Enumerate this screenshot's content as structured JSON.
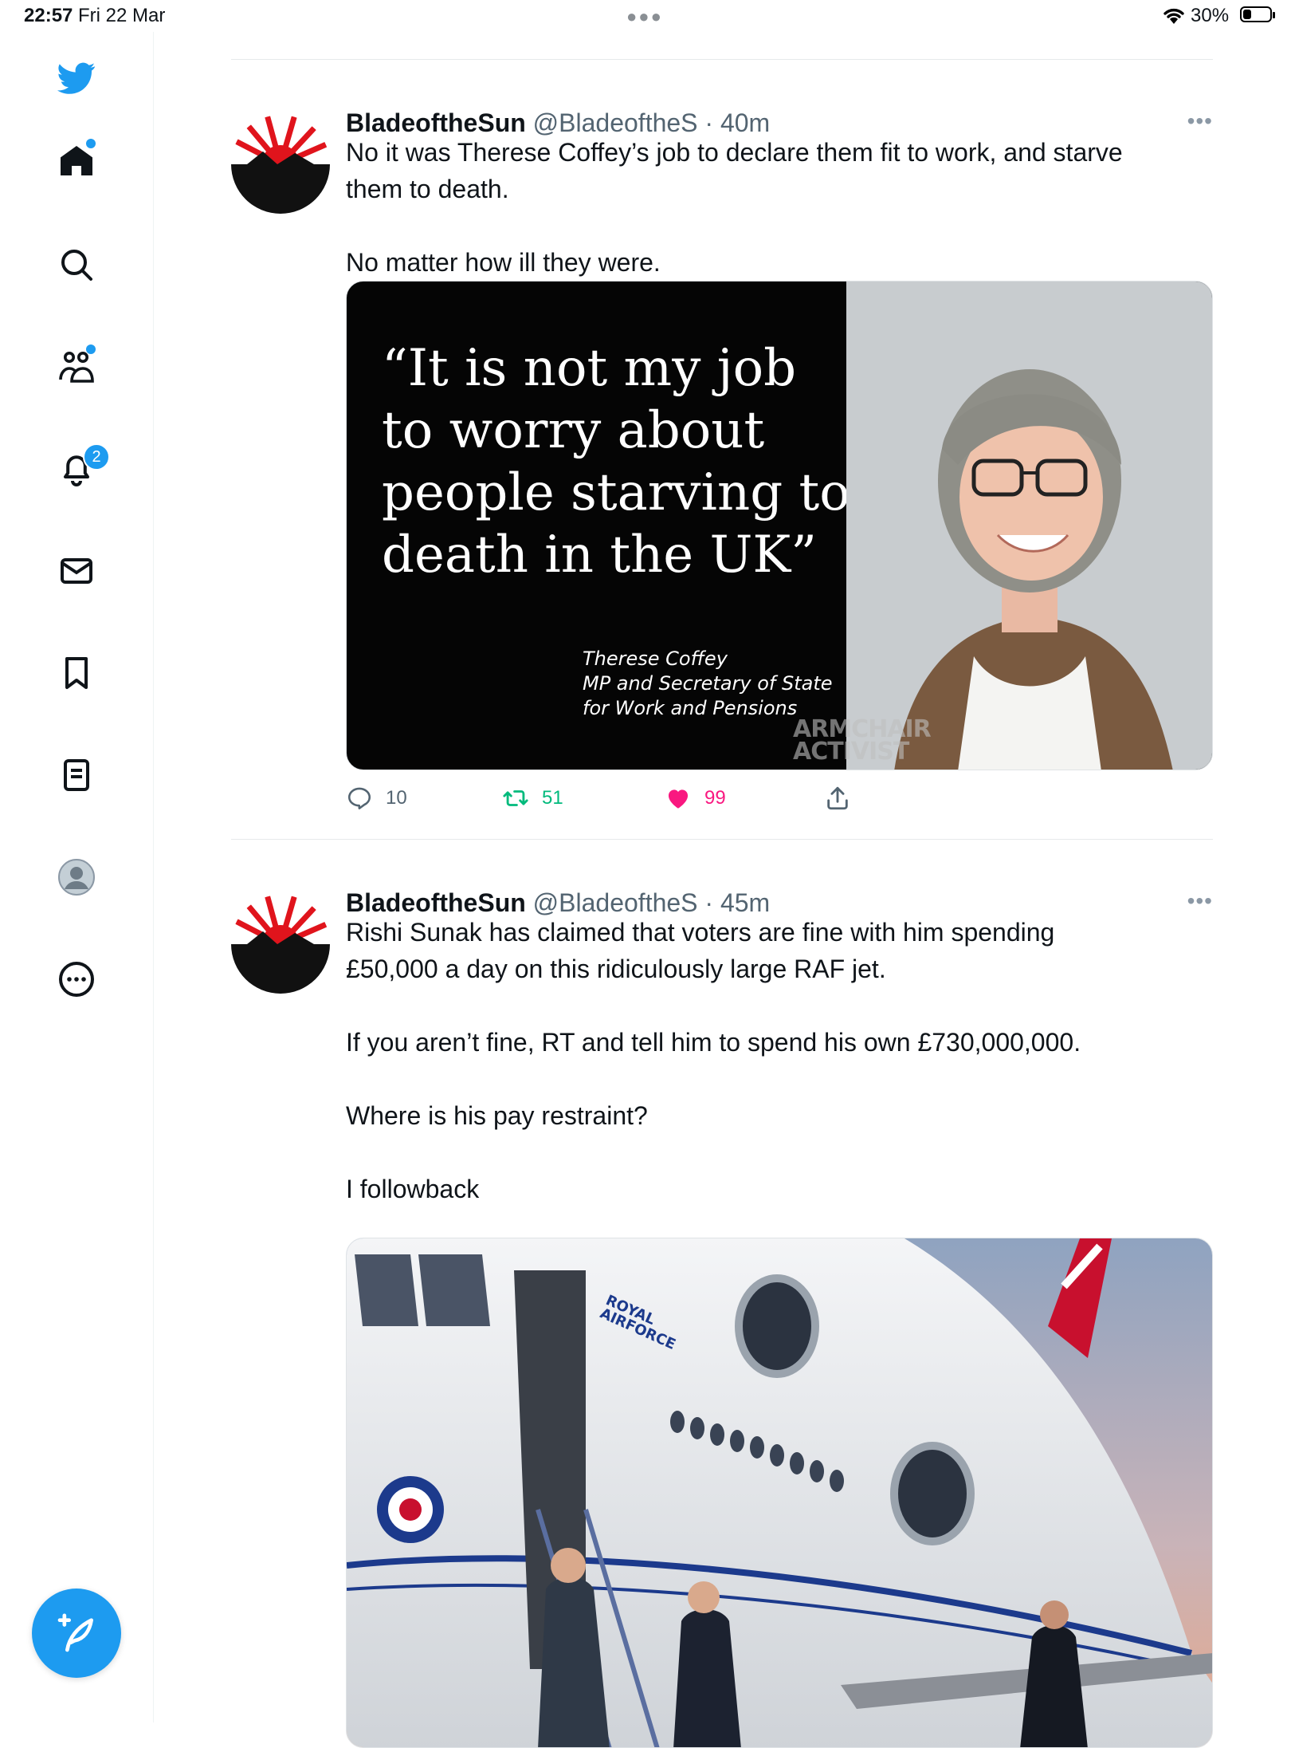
{
  "status_bar": {
    "time": "22:57",
    "date": "Fri 22 Mar",
    "battery_percent": "30%",
    "battery_level": 0.3
  },
  "sidebar": {
    "items": [
      {
        "name": "home",
        "has_dot": true
      },
      {
        "name": "explore"
      },
      {
        "name": "communities",
        "has_dot": true
      },
      {
        "name": "notifications",
        "badge": "2"
      },
      {
        "name": "messages"
      },
      {
        "name": "bookmarks"
      },
      {
        "name": "lists"
      },
      {
        "name": "profile"
      },
      {
        "name": "more"
      }
    ]
  },
  "tweets": [
    {
      "name": "BladeoftheSun",
      "handle": "@BladeoftheS",
      "time": "40m",
      "text": "No it was Therese Coffey’s job to declare them fit to work, and starve\nthem to death.\n\nNo matter how ill they were.",
      "media": {
        "quote": "“It is not my job\nto worry about\npeople starving to\ndeath in the UK”",
        "caption": "Therese Coffey\nMP and Secretary of State\nfor Work and Pensions",
        "watermark": "ARMCHAIR\nACTIVIST"
      },
      "replies": "10",
      "retweets": "51",
      "likes": "99"
    },
    {
      "name": "BladeoftheSun",
      "handle": "@BladeoftheS",
      "time": "45m",
      "text": "Rishi Sunak has claimed that voters are fine with him spending\n£50,000 a day on this ridiculously large RAF jet.\n\nIf you aren’t fine, RT and tell him to spend his own £730,000,000.\n\nWhere is his pay restraint?\n\nI followback",
      "media": {
        "plane_text": "ROYAL\nAIRFORCE"
      }
    }
  ],
  "colors": {
    "accent": "#1d9bf0",
    "like": "#f91880",
    "retweet": "#00ba7c",
    "secondary": "#536471"
  }
}
